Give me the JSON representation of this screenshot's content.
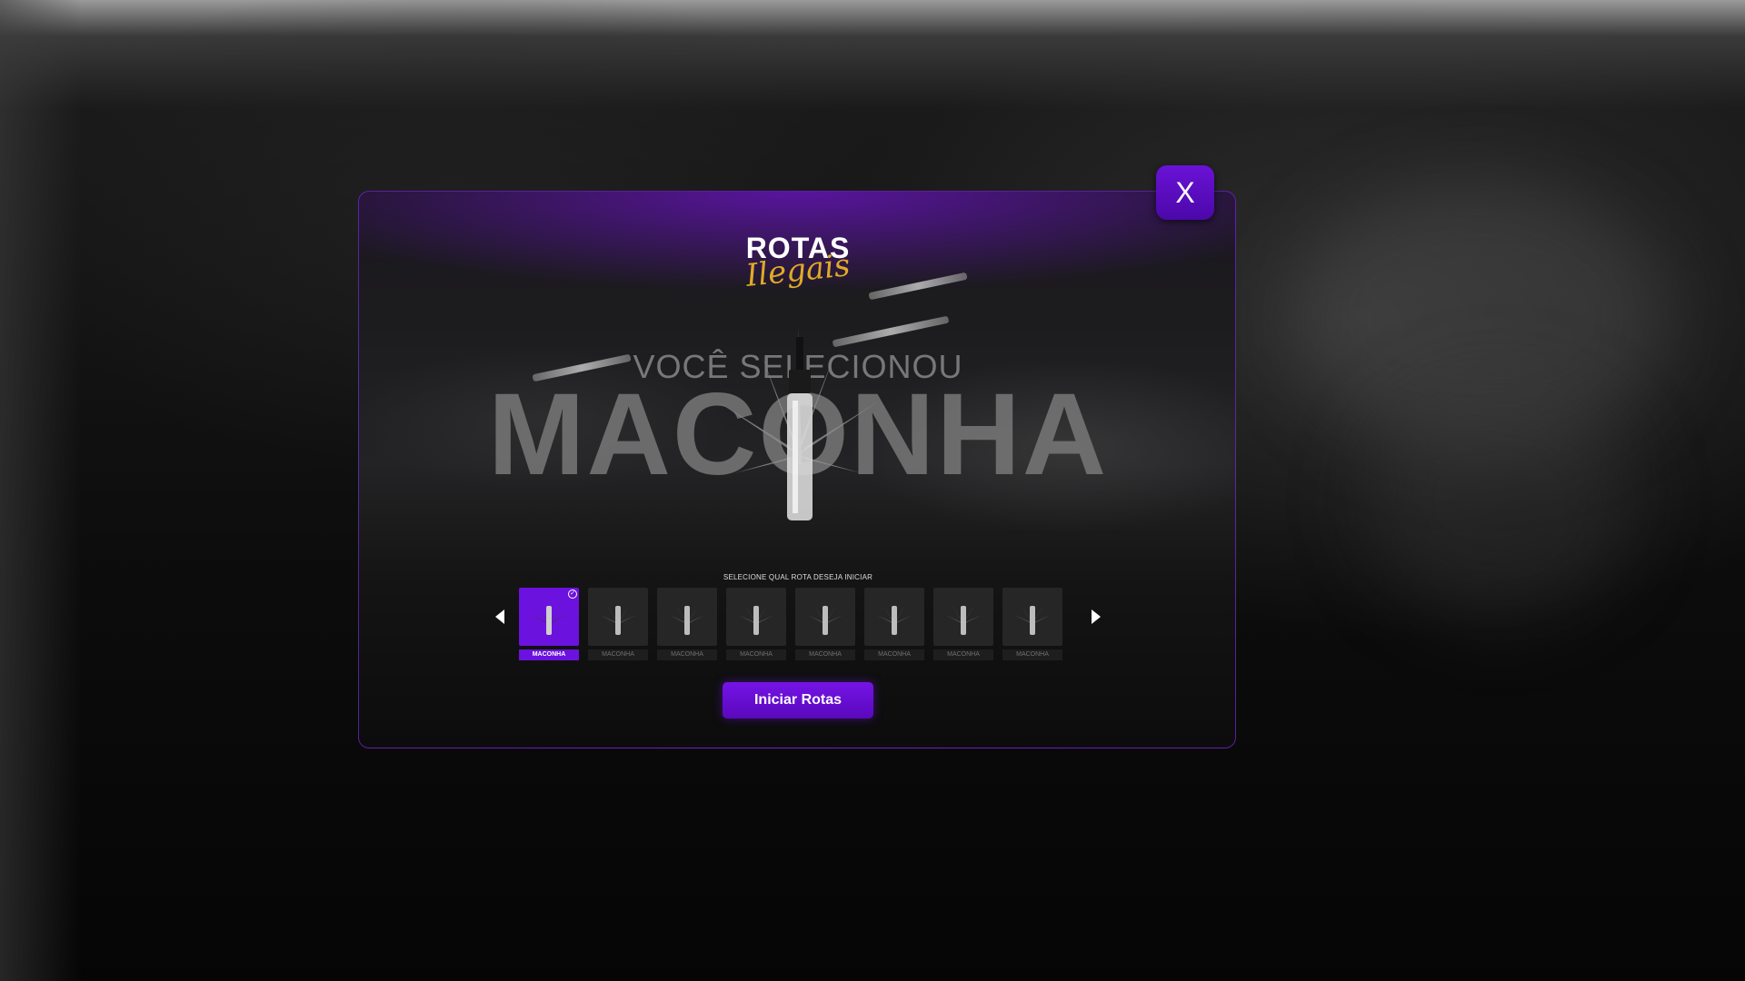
{
  "close_label": "X",
  "logo": {
    "line1": "ROTAS",
    "line2": "Ilegais"
  },
  "selection": {
    "caption": "VOCÊ SELECIONOU",
    "item": "MACONHA"
  },
  "routes": {
    "title": "SELECIONE QUAL ROTA DESEJA INICIAR",
    "items": [
      {
        "label": "MACONHA",
        "selected": true,
        "icon": "cannabis-vial-icon"
      },
      {
        "label": "MACONHA",
        "selected": false,
        "icon": "cannabis-vial-icon"
      },
      {
        "label": "MACONHA",
        "selected": false,
        "icon": "cannabis-vial-icon"
      },
      {
        "label": "MACONHA",
        "selected": false,
        "icon": "cannabis-vial-icon"
      },
      {
        "label": "MACONHA",
        "selected": false,
        "icon": "cannabis-vial-icon"
      },
      {
        "label": "MACONHA",
        "selected": false,
        "icon": "cannabis-vial-icon"
      },
      {
        "label": "MACONHA",
        "selected": false,
        "icon": "cannabis-vial-icon"
      },
      {
        "label": "MACONHA",
        "selected": false,
        "icon": "cannabis-vial-icon"
      }
    ]
  },
  "start_button": "Iniciar Rotas",
  "colors": {
    "accent": "#6c12de",
    "logo_gold": "#e0a92a"
  }
}
